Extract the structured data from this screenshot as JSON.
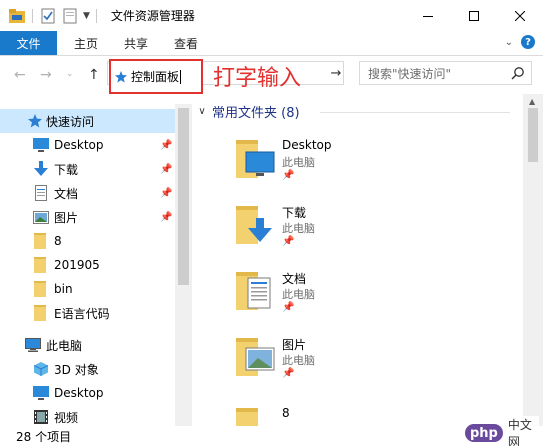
{
  "window": {
    "title": "文件资源管理器"
  },
  "ribbon": {
    "tabs": [
      "文件",
      "主页",
      "共享",
      "查看"
    ]
  },
  "address": {
    "value": "控制面板",
    "annotation": "打字输入"
  },
  "search": {
    "placeholder": "搜索\"快速访问\""
  },
  "nav": {
    "items": [
      {
        "label": "快速访问",
        "icon": "star-icon",
        "pinned": false,
        "selected": true
      },
      {
        "label": "Desktop",
        "icon": "desktop-icon",
        "pinned": true
      },
      {
        "label": "下载",
        "icon": "download-icon",
        "pinned": true
      },
      {
        "label": "文档",
        "icon": "document-icon",
        "pinned": true
      },
      {
        "label": "图片",
        "icon": "picture-icon",
        "pinned": true
      },
      {
        "label": "8",
        "icon": "folder-icon",
        "pinned": false
      },
      {
        "label": "201905",
        "icon": "folder-icon",
        "pinned": false
      },
      {
        "label": "bin",
        "icon": "folder-icon",
        "pinned": false
      },
      {
        "label": "E语言代码",
        "icon": "folder-icon",
        "pinned": false
      },
      {
        "label": "此电脑",
        "icon": "computer-icon",
        "pinned": false
      },
      {
        "label": "3D 对象",
        "icon": "cube-icon",
        "pinned": false
      },
      {
        "label": "Desktop",
        "icon": "desktop-icon",
        "pinned": false
      },
      {
        "label": "视频",
        "icon": "video-icon",
        "pinned": false
      }
    ]
  },
  "content": {
    "group_header": "常用文件夹 (8)",
    "items": [
      {
        "name": "Desktop",
        "location": "此电脑",
        "icon": "desktop-folder-icon"
      },
      {
        "name": "下载",
        "location": "此电脑",
        "icon": "download-folder-icon"
      },
      {
        "name": "文档",
        "location": "此电脑",
        "icon": "document-folder-icon"
      },
      {
        "name": "图片",
        "location": "此电脑",
        "icon": "picture-folder-icon"
      },
      {
        "name": "8",
        "location": "",
        "icon": "folder-icon"
      }
    ]
  },
  "status": {
    "count": "28 个项目"
  },
  "watermark": {
    "brand": "php",
    "site": "中文网"
  },
  "colors": {
    "accent": "#1979ca",
    "selection": "#cce8ff",
    "annotation_red": "#e3312f",
    "group_header": "#1e3287"
  }
}
